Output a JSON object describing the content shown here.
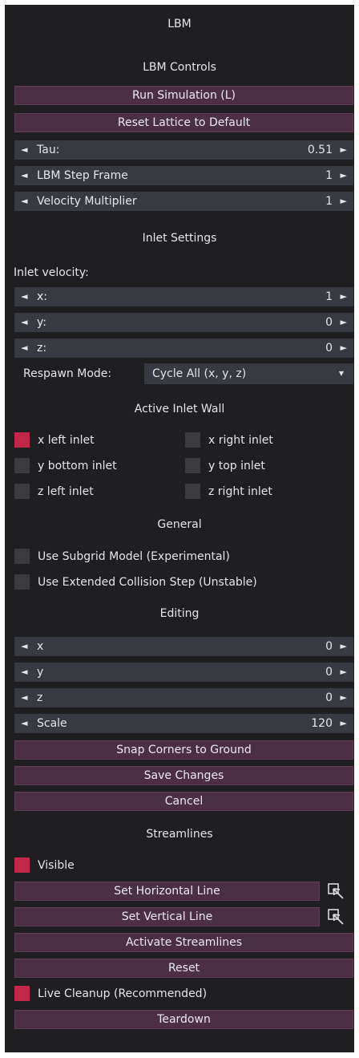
{
  "header": {
    "title": "LBM",
    "section": "LBM Controls"
  },
  "lbm": {
    "run_label": "Run Simulation (L)",
    "reset_label": "Reset Lattice to Default",
    "tau_label": "Tau:",
    "tau_value": "0.51",
    "step_label": "LBM Step Frame",
    "step_value": "1",
    "velmult_label": "Velocity Multiplier",
    "velmult_value": "1"
  },
  "inlet": {
    "title": "Inlet Settings",
    "velocity_label": "Inlet velocity:",
    "x_label": "x:",
    "x_value": "1",
    "y_label": "y:",
    "y_value": "0",
    "z_label": "z:",
    "z_value": "0",
    "respawn_label": "Respawn Mode:",
    "respawn_value": "Cycle All (x, y, z)"
  },
  "walls": {
    "title": "Active Inlet Wall",
    "x_left": "x left inlet",
    "x_right": "x right inlet",
    "y_bottom": "y bottom inlet",
    "y_top": "y top inlet",
    "z_left": "z left inlet",
    "z_right": "z right inlet"
  },
  "general": {
    "title": "General",
    "subgrid": "Use Subgrid Model (Experimental)",
    "extended": "Use Extended Collision Step (Unstable)"
  },
  "editing": {
    "title": "Editing",
    "x_label": "x",
    "x_value": "0",
    "y_label": "y",
    "y_value": "0",
    "z_label": "z",
    "z_value": "0",
    "scale_label": "Scale",
    "scale_value": "120",
    "snap_label": "Snap Corners to Ground",
    "save_label": "Save Changes",
    "cancel_label": "Cancel"
  },
  "streamlines": {
    "title": "Streamlines",
    "visible_label": "Visible",
    "horizontal_label": "Set Horizontal Line",
    "vertical_label": "Set Vertical Line",
    "activate_label": "Activate Streamlines",
    "reset_label": "Reset",
    "cleanup_label": "Live Cleanup (Recommended)",
    "teardown_label": "Teardown"
  },
  "icons": {
    "left_arrow": "◄",
    "right_arrow": "►",
    "dropdown": "▼",
    "picker": "cursor-picker-icon"
  },
  "colors": {
    "accent": "#c2264a",
    "button": "#4a2f45",
    "field": "#383a41",
    "panel": "#1f1f22"
  }
}
